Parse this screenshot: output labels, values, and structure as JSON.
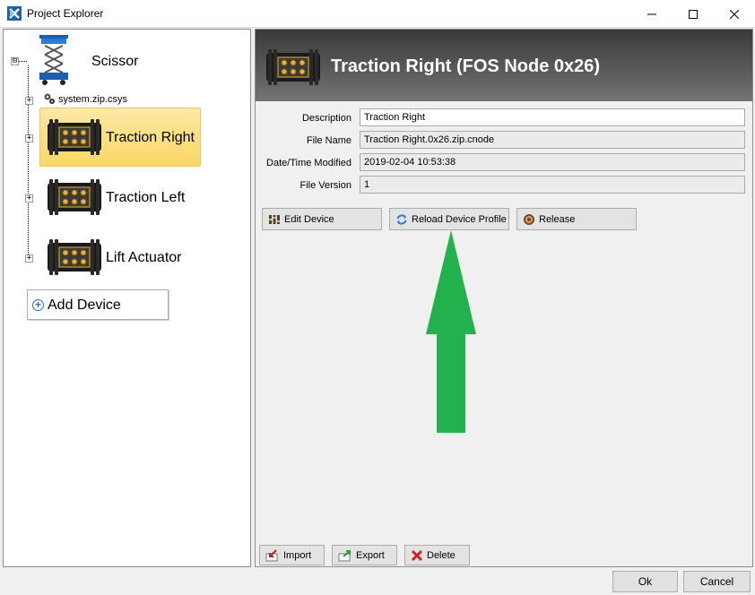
{
  "window": {
    "title": "Project Explorer",
    "icons": {
      "app": "app-logo-icon",
      "minimize": "minimize-icon",
      "maximize": "maximize-icon",
      "close": "close-icon"
    }
  },
  "tree": {
    "root": {
      "label": "Scissor",
      "icon": "scissor-lift-icon",
      "expander": "⊟"
    },
    "system_file": {
      "label": "system.zip.csys",
      "icon": "gears-icon",
      "expander": "+"
    },
    "devices": [
      {
        "label": "Traction Right",
        "icon": "controller-device-icon",
        "selected": true,
        "expander": "+"
      },
      {
        "label": "Traction Left",
        "icon": "controller-device-icon",
        "selected": false,
        "expander": "+"
      },
      {
        "label": "Lift Actuator",
        "icon": "controller-device-icon",
        "selected": false,
        "expander": "+"
      }
    ],
    "add_device": {
      "label": "Add Device",
      "icon": "plus-circle-icon"
    }
  },
  "detail": {
    "title": "Traction Right (FOS Node 0x26)",
    "icon": "controller-device-icon",
    "colors": {
      "header_top": "#3a3a3a",
      "header_bottom": "#737373",
      "title_text": "#ffffff",
      "selection": "#fbd666"
    },
    "fields": {
      "description": {
        "label": "Description",
        "value": "Traction Right"
      },
      "file_name": {
        "label": "File Name",
        "value": "Traction Right.0x26.zip.cnode"
      },
      "modified": {
        "label": "Date/Time Modified",
        "value": "2019-02-04 10:53:38"
      },
      "version": {
        "label": "File Version",
        "value": "1"
      }
    },
    "actions": {
      "edit": {
        "label": "Edit Device",
        "icon": "edit-device-icon"
      },
      "reload": {
        "label": "Reload Device Profile",
        "icon": "refresh-icon"
      },
      "release": {
        "label": "Release",
        "icon": "release-icon"
      }
    },
    "annotation": {
      "icon": "green-up-arrow-icon",
      "color": "#22b14c"
    },
    "bottom_actions": {
      "import": {
        "label": "Import",
        "icon": "import-icon"
      },
      "export": {
        "label": "Export",
        "icon": "export-icon"
      },
      "delete": {
        "label": "Delete",
        "icon": "delete-x-icon"
      }
    }
  },
  "dialog": {
    "ok": "Ok",
    "cancel": "Cancel"
  }
}
